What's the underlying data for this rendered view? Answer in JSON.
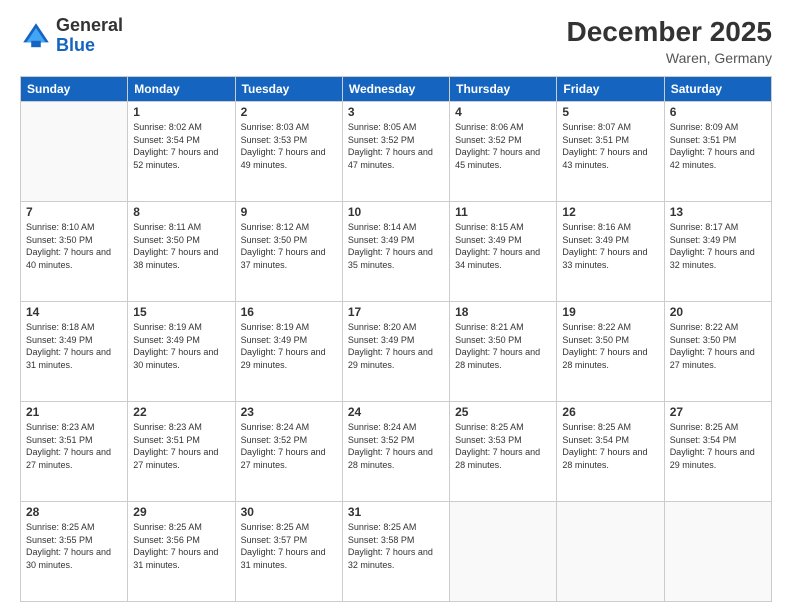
{
  "header": {
    "logo_general": "General",
    "logo_blue": "Blue",
    "month_title": "December 2025",
    "location": "Waren, Germany"
  },
  "weekdays": [
    "Sunday",
    "Monday",
    "Tuesday",
    "Wednesday",
    "Thursday",
    "Friday",
    "Saturday"
  ],
  "weeks": [
    [
      {
        "day": "",
        "sunrise": "",
        "sunset": "",
        "daylight": ""
      },
      {
        "day": "1",
        "sunrise": "Sunrise: 8:02 AM",
        "sunset": "Sunset: 3:54 PM",
        "daylight": "Daylight: 7 hours and 52 minutes."
      },
      {
        "day": "2",
        "sunrise": "Sunrise: 8:03 AM",
        "sunset": "Sunset: 3:53 PM",
        "daylight": "Daylight: 7 hours and 49 minutes."
      },
      {
        "day": "3",
        "sunrise": "Sunrise: 8:05 AM",
        "sunset": "Sunset: 3:52 PM",
        "daylight": "Daylight: 7 hours and 47 minutes."
      },
      {
        "day": "4",
        "sunrise": "Sunrise: 8:06 AM",
        "sunset": "Sunset: 3:52 PM",
        "daylight": "Daylight: 7 hours and 45 minutes."
      },
      {
        "day": "5",
        "sunrise": "Sunrise: 8:07 AM",
        "sunset": "Sunset: 3:51 PM",
        "daylight": "Daylight: 7 hours and 43 minutes."
      },
      {
        "day": "6",
        "sunrise": "Sunrise: 8:09 AM",
        "sunset": "Sunset: 3:51 PM",
        "daylight": "Daylight: 7 hours and 42 minutes."
      }
    ],
    [
      {
        "day": "7",
        "sunrise": "Sunrise: 8:10 AM",
        "sunset": "Sunset: 3:50 PM",
        "daylight": "Daylight: 7 hours and 40 minutes."
      },
      {
        "day": "8",
        "sunrise": "Sunrise: 8:11 AM",
        "sunset": "Sunset: 3:50 PM",
        "daylight": "Daylight: 7 hours and 38 minutes."
      },
      {
        "day": "9",
        "sunrise": "Sunrise: 8:12 AM",
        "sunset": "Sunset: 3:50 PM",
        "daylight": "Daylight: 7 hours and 37 minutes."
      },
      {
        "day": "10",
        "sunrise": "Sunrise: 8:14 AM",
        "sunset": "Sunset: 3:49 PM",
        "daylight": "Daylight: 7 hours and 35 minutes."
      },
      {
        "day": "11",
        "sunrise": "Sunrise: 8:15 AM",
        "sunset": "Sunset: 3:49 PM",
        "daylight": "Daylight: 7 hours and 34 minutes."
      },
      {
        "day": "12",
        "sunrise": "Sunrise: 8:16 AM",
        "sunset": "Sunset: 3:49 PM",
        "daylight": "Daylight: 7 hours and 33 minutes."
      },
      {
        "day": "13",
        "sunrise": "Sunrise: 8:17 AM",
        "sunset": "Sunset: 3:49 PM",
        "daylight": "Daylight: 7 hours and 32 minutes."
      }
    ],
    [
      {
        "day": "14",
        "sunrise": "Sunrise: 8:18 AM",
        "sunset": "Sunset: 3:49 PM",
        "daylight": "Daylight: 7 hours and 31 minutes."
      },
      {
        "day": "15",
        "sunrise": "Sunrise: 8:19 AM",
        "sunset": "Sunset: 3:49 PM",
        "daylight": "Daylight: 7 hours and 30 minutes."
      },
      {
        "day": "16",
        "sunrise": "Sunrise: 8:19 AM",
        "sunset": "Sunset: 3:49 PM",
        "daylight": "Daylight: 7 hours and 29 minutes."
      },
      {
        "day": "17",
        "sunrise": "Sunrise: 8:20 AM",
        "sunset": "Sunset: 3:49 PM",
        "daylight": "Daylight: 7 hours and 29 minutes."
      },
      {
        "day": "18",
        "sunrise": "Sunrise: 8:21 AM",
        "sunset": "Sunset: 3:50 PM",
        "daylight": "Daylight: 7 hours and 28 minutes."
      },
      {
        "day": "19",
        "sunrise": "Sunrise: 8:22 AM",
        "sunset": "Sunset: 3:50 PM",
        "daylight": "Daylight: 7 hours and 28 minutes."
      },
      {
        "day": "20",
        "sunrise": "Sunrise: 8:22 AM",
        "sunset": "Sunset: 3:50 PM",
        "daylight": "Daylight: 7 hours and 27 minutes."
      }
    ],
    [
      {
        "day": "21",
        "sunrise": "Sunrise: 8:23 AM",
        "sunset": "Sunset: 3:51 PM",
        "daylight": "Daylight: 7 hours and 27 minutes."
      },
      {
        "day": "22",
        "sunrise": "Sunrise: 8:23 AM",
        "sunset": "Sunset: 3:51 PM",
        "daylight": "Daylight: 7 hours and 27 minutes."
      },
      {
        "day": "23",
        "sunrise": "Sunrise: 8:24 AM",
        "sunset": "Sunset: 3:52 PM",
        "daylight": "Daylight: 7 hours and 27 minutes."
      },
      {
        "day": "24",
        "sunrise": "Sunrise: 8:24 AM",
        "sunset": "Sunset: 3:52 PM",
        "daylight": "Daylight: 7 hours and 28 minutes."
      },
      {
        "day": "25",
        "sunrise": "Sunrise: 8:25 AM",
        "sunset": "Sunset: 3:53 PM",
        "daylight": "Daylight: 7 hours and 28 minutes."
      },
      {
        "day": "26",
        "sunrise": "Sunrise: 8:25 AM",
        "sunset": "Sunset: 3:54 PM",
        "daylight": "Daylight: 7 hours and 28 minutes."
      },
      {
        "day": "27",
        "sunrise": "Sunrise: 8:25 AM",
        "sunset": "Sunset: 3:54 PM",
        "daylight": "Daylight: 7 hours and 29 minutes."
      }
    ],
    [
      {
        "day": "28",
        "sunrise": "Sunrise: 8:25 AM",
        "sunset": "Sunset: 3:55 PM",
        "daylight": "Daylight: 7 hours and 30 minutes."
      },
      {
        "day": "29",
        "sunrise": "Sunrise: 8:25 AM",
        "sunset": "Sunset: 3:56 PM",
        "daylight": "Daylight: 7 hours and 31 minutes."
      },
      {
        "day": "30",
        "sunrise": "Sunrise: 8:25 AM",
        "sunset": "Sunset: 3:57 PM",
        "daylight": "Daylight: 7 hours and 31 minutes."
      },
      {
        "day": "31",
        "sunrise": "Sunrise: 8:25 AM",
        "sunset": "Sunset: 3:58 PM",
        "daylight": "Daylight: 7 hours and 32 minutes."
      },
      {
        "day": "",
        "sunrise": "",
        "sunset": "",
        "daylight": ""
      },
      {
        "day": "",
        "sunrise": "",
        "sunset": "",
        "daylight": ""
      },
      {
        "day": "",
        "sunrise": "",
        "sunset": "",
        "daylight": ""
      }
    ]
  ]
}
